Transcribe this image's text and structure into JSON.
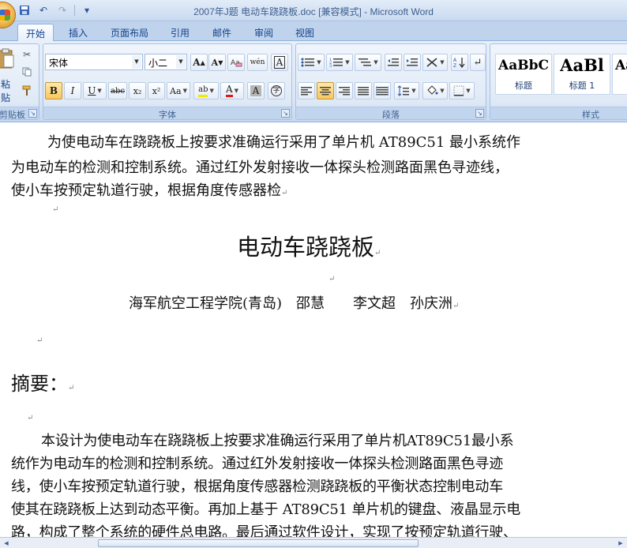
{
  "window": {
    "title": "2007年J题 电动车跷跷板.doc [兼容模式] - Microsoft Word"
  },
  "quick_access": {
    "undo_symbol": "↶",
    "redo_symbol": "↷",
    "menu_symbol": "▾"
  },
  "tabs": [
    "开始",
    "插入",
    "页面布局",
    "引用",
    "邮件",
    "审阅",
    "视图"
  ],
  "ribbon": {
    "clipboard": {
      "paste_label": "粘贴",
      "group_label": "剪贴板"
    },
    "font": {
      "font_name": "宋体",
      "font_size": "小二",
      "group_label": "字体",
      "grow_label": "A",
      "shrink_label": "A",
      "bold_label": "B",
      "italic_label": "I",
      "underline_label": "U",
      "strike_label": "abc",
      "subscript_label": "x₂",
      "superscript_label": "x²",
      "case_label": "Aa",
      "highlight_label": "ab",
      "color_label": "A",
      "shade_label": "A",
      "phonetic_label": "wén",
      "border_label": "A",
      "enclose_label": "字"
    },
    "paragraph": {
      "group_label": "段落"
    },
    "styles": {
      "group_label": "样式",
      "items": [
        {
          "preview": "AaBbC",
          "name": "标题"
        },
        {
          "preview": "AaBl",
          "name": "标题 1"
        },
        {
          "preview": "Aa",
          "name": ""
        }
      ]
    }
  },
  "document": {
    "para1": [
      "为使电动车在跷跷板上按要求准确运行采用了单片机 AT89C51 最小系统作",
      "为电动车的检测和控制系统。通过红外发射接收一体探头检测路面黑色寻迹线，",
      "使小车按预定轨道行驶，根据角度传感器检"
    ],
    "title": "电动车跷跷板",
    "authors": "海军航空工程学院(青岛)　邵慧　　李文超　孙庆洲",
    "abstract_heading": "摘要：",
    "abstract": [
      "本设计为使电动车在跷跷板上按要求准确运行采用了单片机AT89C51最小系",
      "统作为电动车的检测和控制系统。通过红外发射接收一体探头检测路面黑色寻迹",
      "线，使小车按预定轨道行驶，根据角度传感器检测跷跷板的平衡状态控制电动车",
      "使其在跷跷板上达到动态平衡。再加上基于 AT89C51 单片机的键盘、液晶显示电",
      "路，构成了整个系统的硬件总电路。最后通过软件设计，实现了按预定轨道行驶、"
    ],
    "para_mark": "↵"
  }
}
